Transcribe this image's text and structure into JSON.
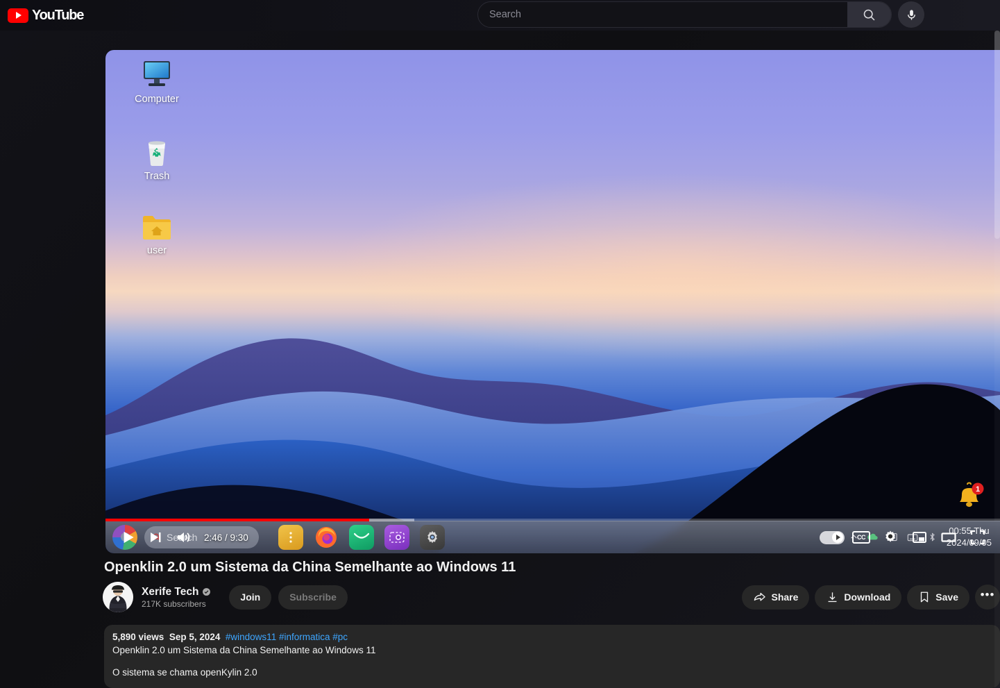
{
  "masthead": {
    "logo_text": "YouTube",
    "search": {
      "placeholder": "Search",
      "value": ""
    },
    "search_button_name": "search-submit-button",
    "mic_button_name": "voice-search-button"
  },
  "player": {
    "current_time": "2:46",
    "duration": "9:30",
    "time_display": "2:46 / 9:30",
    "progress_percent": 29.5,
    "buffer_percent": 34.5,
    "controls": {
      "play": "Play",
      "next": "Next",
      "volume": "Volume",
      "autoplay": "Autoplay",
      "subtitles": "CC",
      "settings": "Settings",
      "miniplayer": "Miniplayer",
      "theater": "Theater mode",
      "fullscreen": "Full screen"
    }
  },
  "video_content": {
    "desktop_icons": [
      {
        "label": "Computer",
        "icon": "monitor-icon"
      },
      {
        "label": "Trash",
        "icon": "trash-icon"
      },
      {
        "label": "user",
        "icon": "home-folder-icon"
      }
    ],
    "taskbar": {
      "search_placeholder": "Search",
      "apps": [
        {
          "name": "files-app-icon",
          "color": "#e3a93c"
        },
        {
          "name": "firefox-app-icon",
          "color": "#ff7139"
        },
        {
          "name": "mail-app-icon",
          "color": "#17b97a"
        },
        {
          "name": "screenshot-app-icon",
          "color": "#8e44d0"
        },
        {
          "name": "settings-app-icon",
          "color": "#4a4a4a"
        }
      ],
      "clock_time": "00:55  Thu",
      "clock_date": "2024/09/05"
    },
    "notification_badge": "1"
  },
  "video": {
    "title": "Openklin 2.0 um Sistema da China Semelhante ao Windows 11",
    "channel": {
      "name": "Xerife Tech",
      "subscribers": "217K subscribers",
      "verified": true
    },
    "join_label": "Join",
    "subscribe_label": "Subscribe",
    "actions": [
      {
        "label": "Share",
        "icon": "share-icon"
      },
      {
        "label": "Download",
        "icon": "download-icon"
      },
      {
        "label": "Save",
        "icon": "bookmark-icon"
      }
    ],
    "more_label": "•••"
  },
  "description": {
    "views": "5,890 views",
    "date": "Sep 5, 2024",
    "hashtags": "#windows11 #informatica #pc",
    "line1": "Openklin 2.0 um Sistema da China Semelhante ao Windows 11",
    "line2": "O sistema se chama openKylin 2.0"
  }
}
